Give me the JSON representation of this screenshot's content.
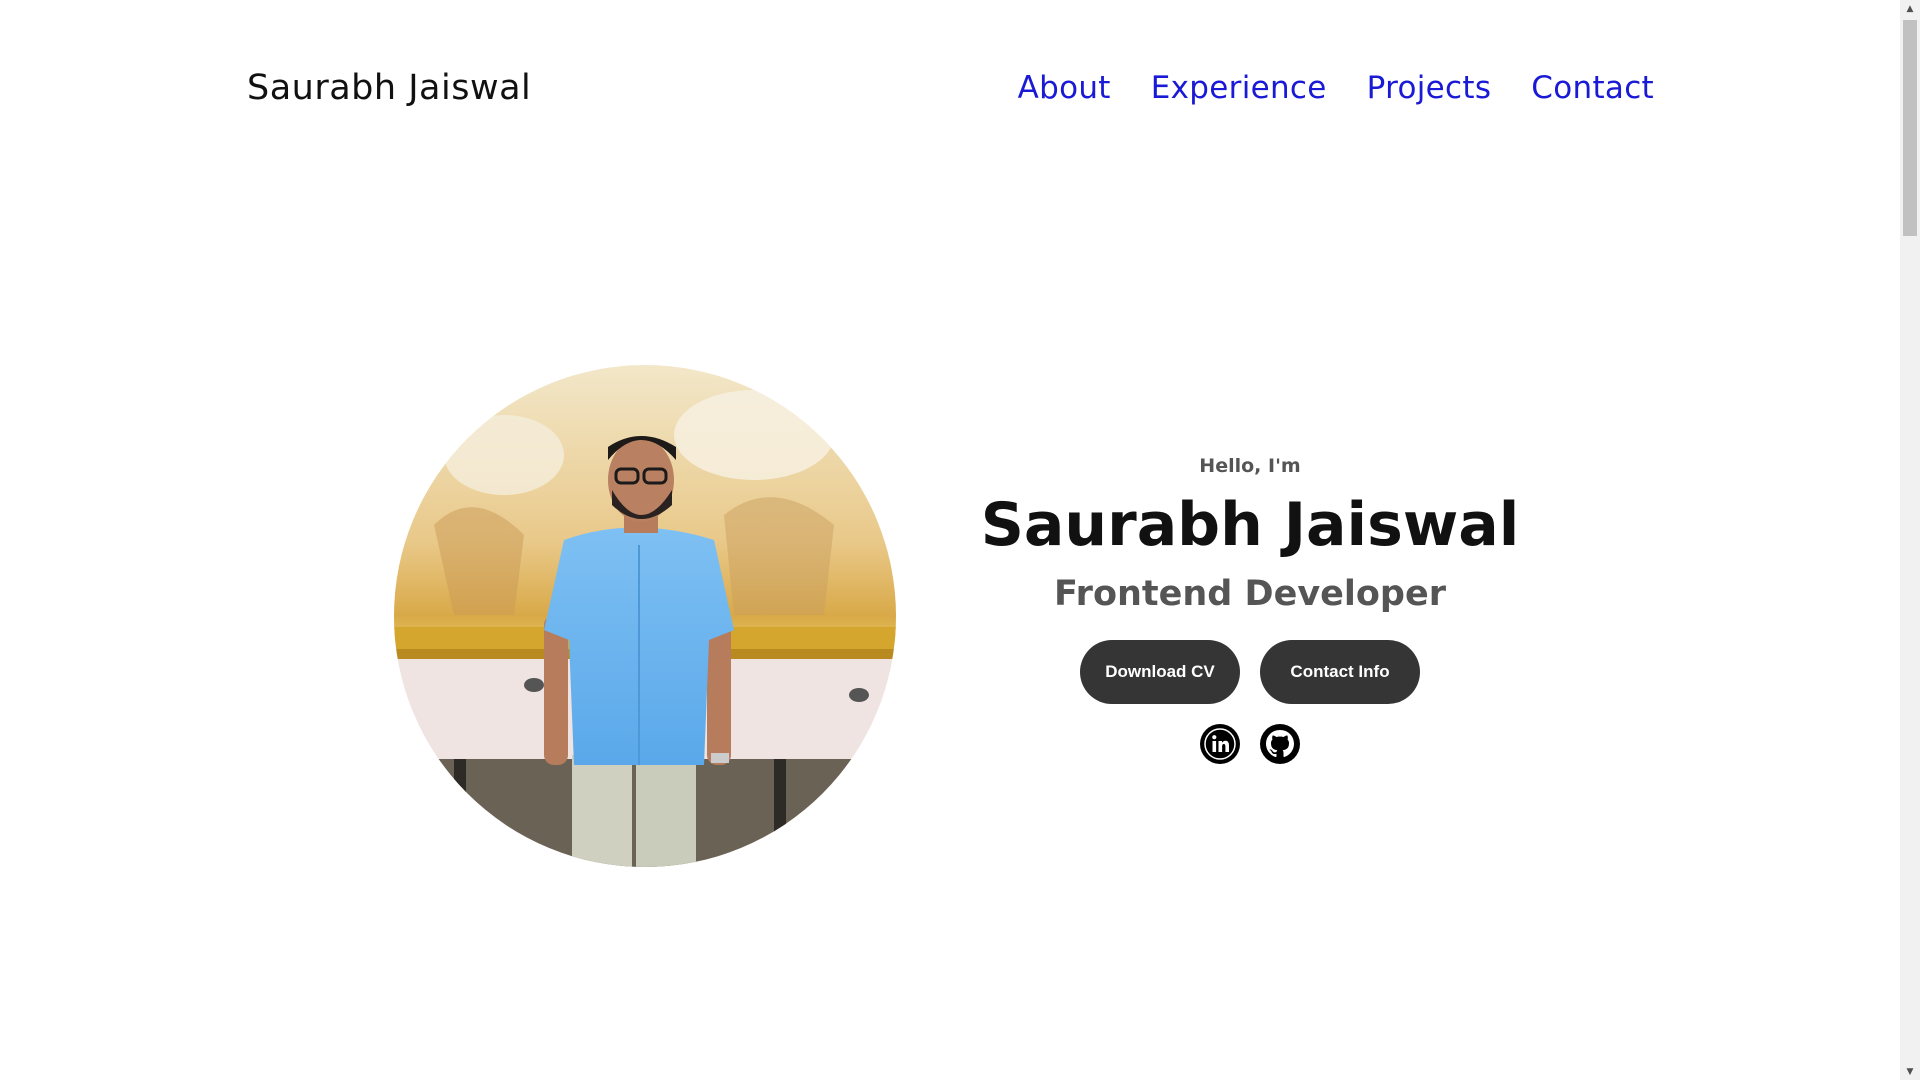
{
  "nav": {
    "logo": "Saurabh Jaiswal",
    "links": [
      "About",
      "Experience",
      "Projects",
      "Contact"
    ]
  },
  "hero": {
    "greeting": "Hello, I'm",
    "name": "Saurabh Jaiswal",
    "role": "Frontend Developer",
    "buttons": {
      "download_cv": "Download CV",
      "contact_info": "Contact Info"
    },
    "socials": [
      "linkedin-icon",
      "github-icon"
    ],
    "photo": "profile-photo"
  },
  "colors": {
    "nav_link": "#1a1ad6",
    "button_bg": "#353535",
    "text_dark": "#111111",
    "text_muted": "#555555"
  },
  "scrollbar": {
    "up_arrow": "▲",
    "down_arrow": "▼"
  }
}
